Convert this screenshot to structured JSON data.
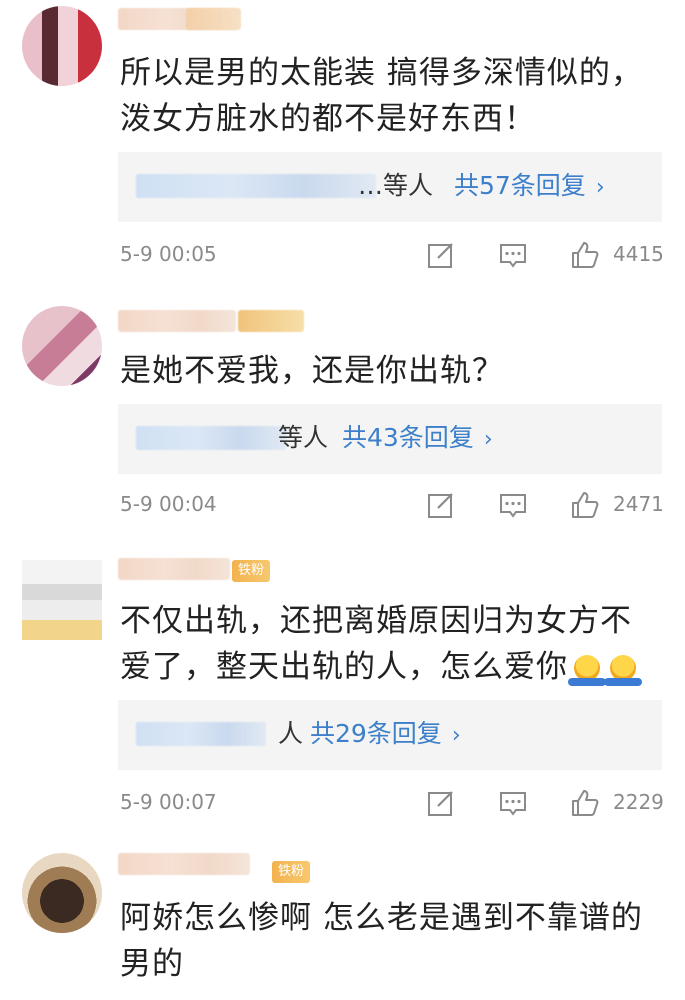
{
  "comments": [
    {
      "text_line1": "所以是男的太能装 搞得多深情似的，",
      "text_line2": "泼女方脏水的都不是好东西！",
      "reply_suffix": "…等人",
      "reply_link": "共57条回复",
      "time": "5-9 00:05",
      "likes": "4415"
    },
    {
      "text_line1": "是她不爱我，还是你出轨？",
      "reply_suffix": "等人",
      "reply_link": "共43条回复",
      "time": "5-9 00:04",
      "likes": "2471"
    },
    {
      "text_line1": "不仅出轨，还把离婚原因归为女方不",
      "text_line2": "爱了，整天出轨的人，怎么爱你",
      "badge": "铁粉",
      "reply_suffix": "人",
      "reply_link": "共29条回复",
      "time": "5-9 00:07",
      "likes": "2229"
    },
    {
      "text_line1": "阿娇怎么惨啊 怎么老是遇到不靠谱的",
      "text_line2": "男的",
      "badge": "铁粉"
    }
  ],
  "icons": {
    "edit": "edit-icon",
    "comment": "comment-icon",
    "like": "thumbs-up-icon",
    "emoji": "shrug-emoji-icon"
  },
  "colors": {
    "link": "#3d7fca",
    "text": "#222222",
    "meta": "#8a8a8a",
    "reply_bg": "#f4f4f4",
    "badge": "#f3b24e"
  }
}
